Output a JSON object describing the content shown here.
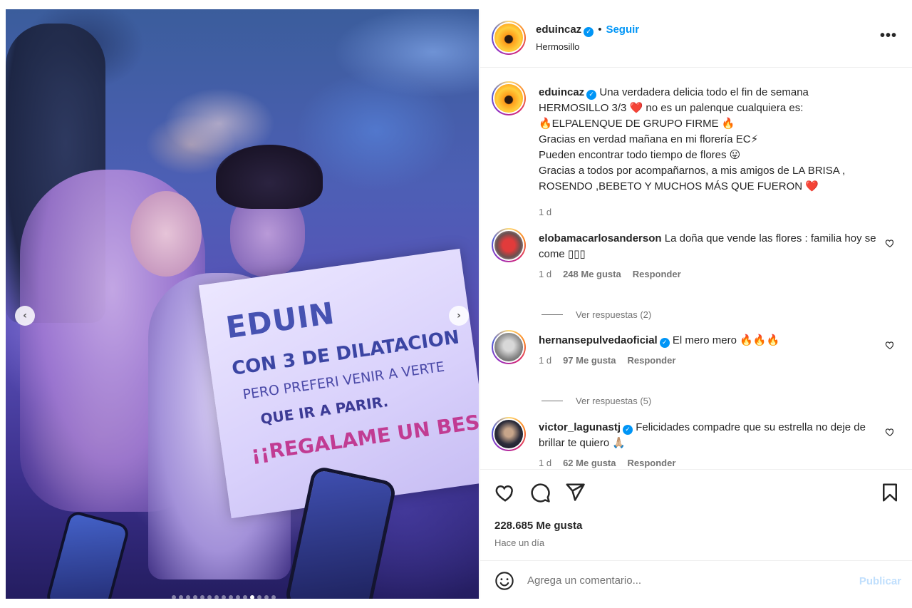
{
  "media": {
    "sign_lines": [
      "EDUIN",
      "CON 3 DE DILATACION",
      "PERO PREFERI VENIR A VERTE",
      "QUE IR A PARIR.",
      "¡¡REGALAME UN BESO!!"
    ],
    "slide_count": 15,
    "active_slide": 11,
    "prev_arrow": "‹",
    "next_arrow": "›"
  },
  "post": {
    "author": "eduincaz",
    "follow_label": "Seguir",
    "separator": "•",
    "location": "Hermosillo",
    "more_label": "•••",
    "caption": {
      "username": "eduincaz",
      "lines": [
        "Una verdadera delicia todo el fin de semana",
        "HERMOSILLO 3/3 ❤️ no es un palenque cualquiera es:",
        "🔥ELPALENQUE DE GRUPO FIRME 🔥",
        "Gracias en verdad mañana en mi florería EC⚡",
        "Pueden encontrar todo tiempo de flores 😛",
        "Gracias a todos por acompañarnos, a mis amigos de LA BRISA ,",
        "ROSENDO ,BEBETO Y MUCHOS MÁS QUE FUERON ❤️"
      ],
      "time": "1 d"
    },
    "comments": [
      {
        "username": "elobamacarlosanderson",
        "verified": false,
        "text": "La doña que vende las flores : familia hoy se come ▯▯▯",
        "time": "1 d",
        "likes": "248 Me gusta",
        "reply_label": "Responder",
        "view_replies": "Ver respuestas (2)"
      },
      {
        "username": "hernansepulvedaoficial",
        "verified": true,
        "text": "El mero mero 🔥🔥🔥",
        "time": "1 d",
        "likes": "97 Me gusta",
        "reply_label": "Responder",
        "view_replies": "Ver respuestas (5)"
      },
      {
        "username": "victor_lagunastj",
        "verified": true,
        "text": "Felicidades compadre que su estrella no deje de brillar te quiero 🙏🏼",
        "time": "1 d",
        "likes": "62 Me gusta",
        "reply_label": "Responder",
        "view_replies": ""
      }
    ],
    "likes_total": "228.685 Me gusta",
    "posted_ago": "Hace un día",
    "comment_placeholder": "Agrega un comentario...",
    "publish_label": "Publicar"
  },
  "icons": {
    "like": "heart-icon",
    "comment": "comment-icon",
    "share": "share-icon",
    "save": "bookmark-icon",
    "emoji": "emoji-icon",
    "verified": "verified-badge-icon"
  },
  "colors": {
    "link_blue": "#0095f6",
    "publish_disabled": "#c0dffd",
    "muted_text": "#737373"
  }
}
